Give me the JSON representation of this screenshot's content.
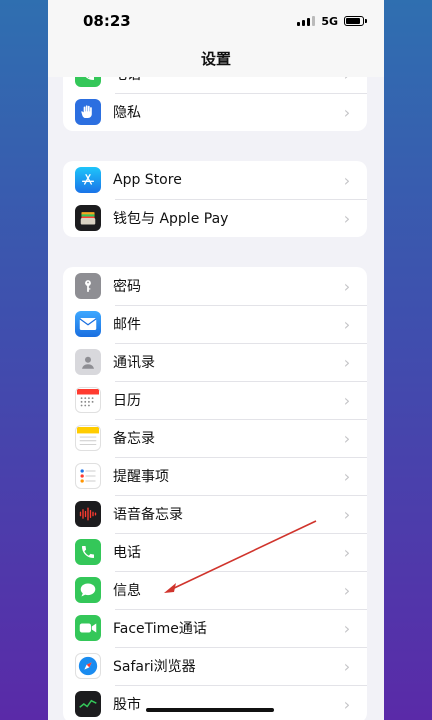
{
  "status": {
    "time": "08:23",
    "network": "5G",
    "battery_level": 0.85
  },
  "nav": {
    "title": "设置"
  },
  "groups": [
    {
      "items": [
        {
          "label": "电话",
          "icon": "phone-icon"
        },
        {
          "label": "隐私",
          "icon": "hand-icon"
        }
      ]
    },
    {
      "items": [
        {
          "label": "App Store",
          "icon": "app-store-icon"
        },
        {
          "label": "钱包与 Apple Pay",
          "icon": "wallet-icon"
        }
      ]
    },
    {
      "items": [
        {
          "label": "密码",
          "icon": "key-icon"
        },
        {
          "label": "邮件",
          "icon": "mail-icon"
        },
        {
          "label": "通讯录",
          "icon": "contacts-icon"
        },
        {
          "label": "日历",
          "icon": "calendar-icon"
        },
        {
          "label": "备忘录",
          "icon": "notes-icon"
        },
        {
          "label": "提醒事项",
          "icon": "reminders-icon"
        },
        {
          "label": "语音备忘录",
          "icon": "voice-memos-icon"
        },
        {
          "label": "电话",
          "icon": "phone-icon"
        },
        {
          "label": "信息",
          "icon": "messages-icon"
        },
        {
          "label": "FaceTime通话",
          "icon": "facetime-icon"
        },
        {
          "label": "Safari浏览器",
          "icon": "safari-icon"
        },
        {
          "label": "股市",
          "icon": "stocks-icon"
        }
      ]
    }
  ],
  "colors": {
    "accent_green": "#34c759",
    "accent_blue": "#1a73e8",
    "annotation_red": "#d0342c"
  }
}
